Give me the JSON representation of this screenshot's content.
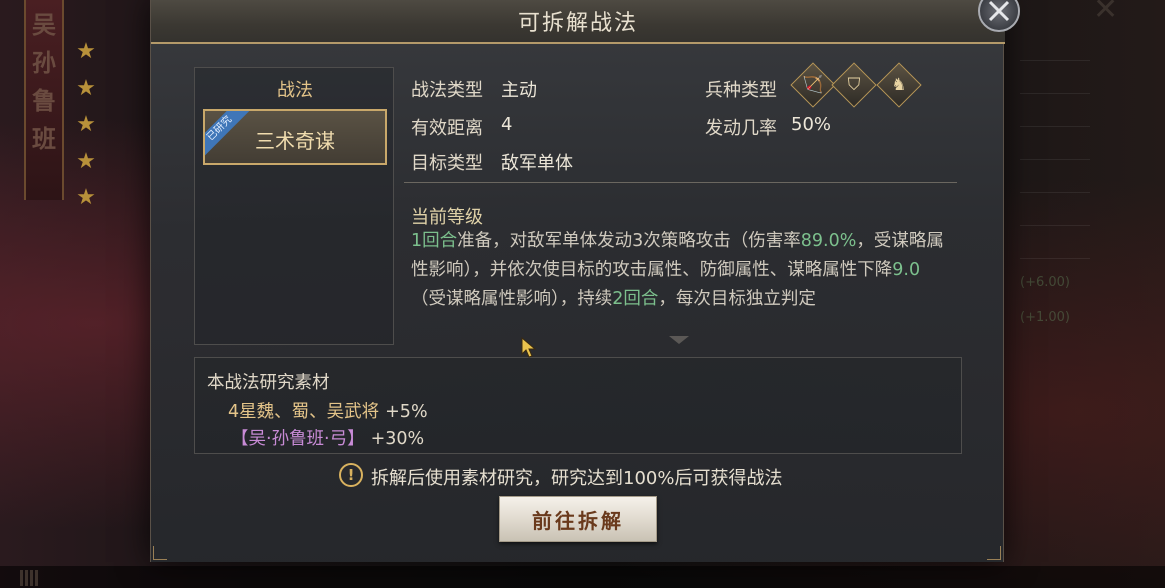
{
  "dialog": {
    "title": "可拆解战法",
    "close_icon": "close-icon"
  },
  "skill_list": {
    "header": "战法",
    "items": [
      {
        "name": "三术奇谋",
        "badge": "已研究"
      }
    ]
  },
  "skill_info": {
    "type_label": "战法类型",
    "type_value": "主动",
    "range_label": "有效距离",
    "range_value": "4",
    "target_label": "目标类型",
    "target_value": "敌军单体",
    "troop_label": "兵种类型",
    "troop_icons": [
      "archer-icon",
      "shield-icon",
      "cavalry-icon"
    ],
    "chance_label": "发动几率",
    "chance_value": "50%"
  },
  "level": {
    "heading": "当前等级",
    "desc": {
      "p1": "1回合",
      "p2": "准备，对敌军单体发动3次策略攻击（伤害率",
      "p3": "89.0%",
      "p4": "，受谋略属性影响），并依次使目标的攻击属性、防御属性、谋略属性下降",
      "p5": "9.0",
      "p6": "（受谋略属性影响），持续",
      "p7": "2回合",
      "p8": "，每次目标独立判定"
    }
  },
  "materials": {
    "title": "本战法研究素材",
    "items": [
      {
        "name": "4星魏、蜀、吴武将",
        "bonus": "+5%"
      },
      {
        "name": "【吴·孙鲁班·弓】",
        "bonus": "+30%"
      }
    ]
  },
  "notice": {
    "icon": "!",
    "text": "拆解后使用素材研究，研究达到100%后可获得战法"
  },
  "action_button": "前往拆解",
  "background": {
    "left_name": "吴孙鲁班",
    "star_count": 5,
    "right_values": [
      "(+6.00)",
      "(+1.00)"
    ]
  },
  "colors": {
    "gold": "#e4c489",
    "green_highlight": "#7cc08d",
    "purple_name": "#c88bd6",
    "badge_blue": "#3f76b8"
  }
}
